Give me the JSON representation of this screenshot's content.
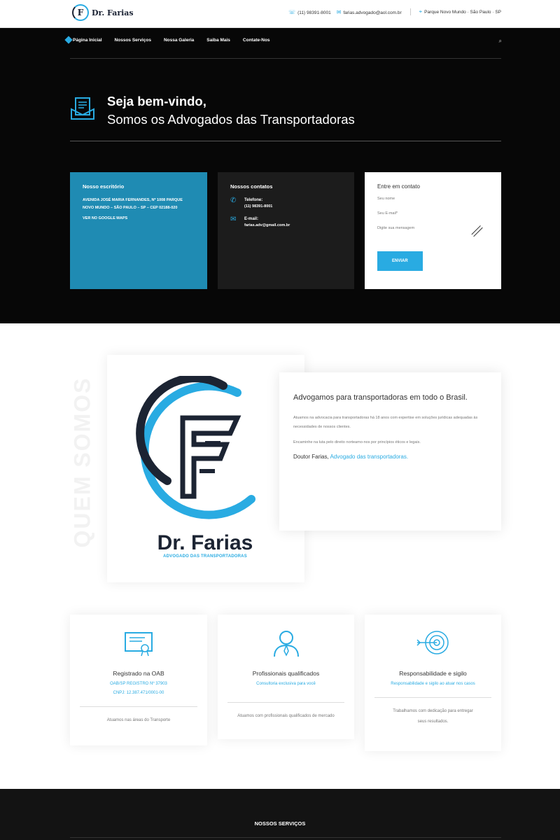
{
  "topbar": {
    "logo": "Dr. Farias",
    "phone": "(11) 98391-8001",
    "email": "farias.advogado@aol.com.br",
    "address": "Parque Novo Mundo · São Paulo · SP"
  },
  "nav": {
    "items": [
      "Página Inicial",
      "Nossos Serviços",
      "Nossa Galeria",
      "Saiba Mais",
      "Contate-Nos"
    ]
  },
  "hero": {
    "line1": "Seja bem-vindo,",
    "line2": "Somos os Advogados das Transportadoras"
  },
  "office": {
    "title": "Nosso escritório",
    "address": "AVENIDA JOSÉ MARIA FERNANDES, Nº 1008 PARQUE NOVO MUNDO – SÃO PAULO – SP – CEP 02188-020",
    "maps": "VER NO GOOGLE MAPS"
  },
  "contacts": {
    "title": "Nossos contatos",
    "phone_label": "Telefone:",
    "phone_value": "(11) 98391-8001",
    "email_label": "E-mail:",
    "email_value": "farias.adv@gmail.com.br"
  },
  "form": {
    "title": "Entre em contato",
    "name_ph": "Seu nome",
    "email_ph": "Seu E-mail*",
    "msg_ph": "Digite sua mensagem",
    "send": "ENVIAR"
  },
  "about": {
    "vertical": "QUEM SOMOS",
    "logo_name": "Dr. Farias",
    "logo_sub": "ADVOGADO DAS TRANSPORTADORAS",
    "heading": "Advogamos para transportadoras em todo o Brasil.",
    "p1": "Atuamos na advocacia para transportadoras há 18 anos com expertise em soluções jurídicas adequadas às necessidades de nossos clientes.",
    "p2": "Encaminhe na luta pelo direito norteamo-nos por princípios éticos e legais.",
    "sig_name": "Doutor Farias,",
    "sig_role": "Advogado das transportadoras."
  },
  "features": [
    {
      "title": "Registrado na OAB",
      "blue1": "OAB/SP REGISTRO Nº 37903",
      "blue2": "CNPJ: 12.387.471/0001-00",
      "text": "Atuamos nas áreas do Transporte"
    },
    {
      "title": "Profissionais qualificados",
      "blue1": "Consultoria exclusiva para você",
      "blue2": "",
      "text": "Atuamos com profissionais qualificados de mercado"
    },
    {
      "title": "Responsabilidade e sigilo",
      "blue1": "Responsabilidade e sigilo ao atuar nos casos",
      "blue2": "",
      "text": "Trabalhamos com dedicação para entregar seus resultados."
    }
  ],
  "footer": {
    "title": "NOSSOS SERVIÇOS"
  },
  "colors": {
    "accent": "#29abe2",
    "dark": "#070707",
    "blue_card": "#1f8bb3"
  }
}
